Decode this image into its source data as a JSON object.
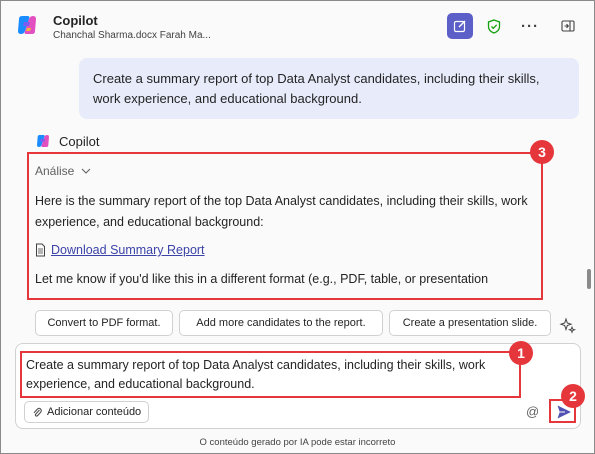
{
  "header": {
    "title": "Copilot",
    "subtitle": "Chanchal Sharma.docx Farah Ma...",
    "more_label": "···"
  },
  "conversation": {
    "user_message": "Create a summary report of top Data Analyst candidates, including their skills, work experience, and educational background.",
    "copilot_name": "Copilot",
    "analysis_label": "Análise",
    "response_intro": "Here is the summary report of the top Data Analyst candidates, including their skills, work experience, and educational background:",
    "download_link": "Download Summary Report",
    "followup": "Let me know if you'd like this in a different format (e.g., PDF, table, or presentation"
  },
  "suggestions": [
    "Convert to PDF format.",
    "Add more candidates to the report.",
    "Create a presentation slide."
  ],
  "composer": {
    "text": "Create a summary report of top Data Analyst candidates, including their skills, work experience, and educational background.",
    "add_content_label": "Adicionar conteúdo",
    "mention_symbol": "@"
  },
  "disclaimer": "O conteúdo gerado por IA pode estar incorreto",
  "annotations": [
    "1",
    "2",
    "3"
  ],
  "colors": {
    "accent": "#5b5fc7",
    "annotation_red": "#e5373b",
    "user_bubble": "#e8ebfa",
    "link": "#3b43a8"
  },
  "icons": [
    "copilot-logo-icon",
    "new-chat-icon",
    "shield-check-icon",
    "more-icon",
    "exit-panel-icon",
    "chevron-down-icon",
    "document-icon",
    "sparkle-icon",
    "paperclip-icon",
    "mention-icon",
    "send-icon"
  ]
}
